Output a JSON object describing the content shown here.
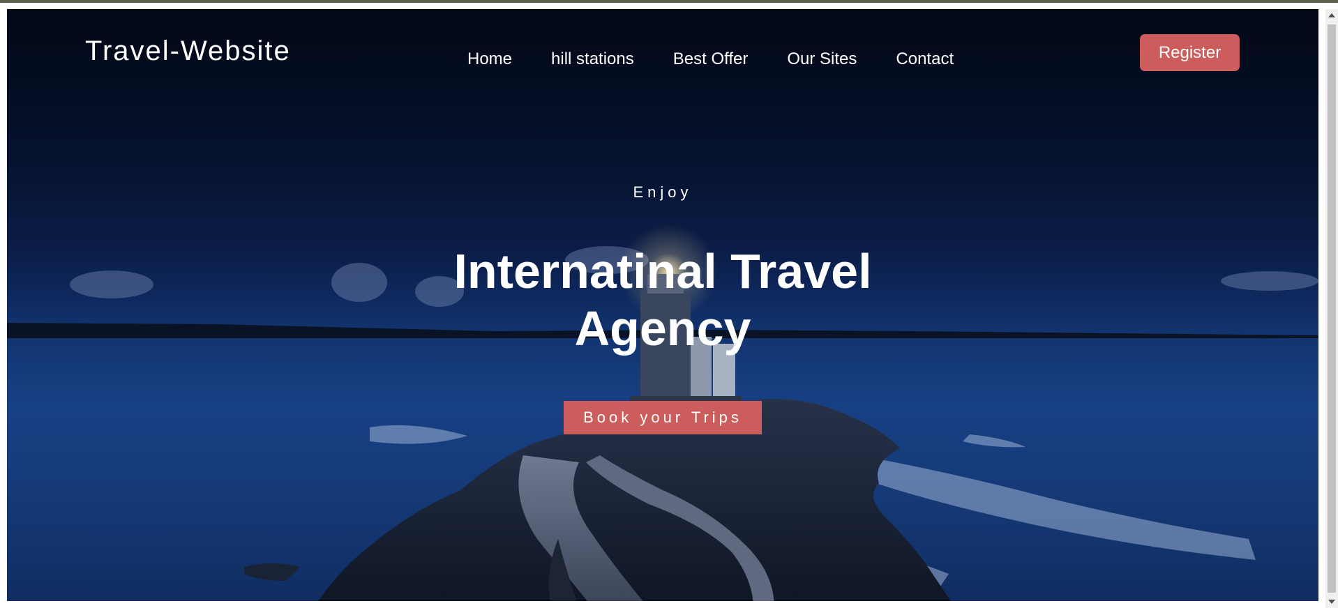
{
  "header": {
    "logo": "Travel-Website",
    "nav": [
      {
        "label": "Home"
      },
      {
        "label": "hill stations"
      },
      {
        "label": "Best Offer"
      },
      {
        "label": "Our Sites"
      },
      {
        "label": "Contact"
      }
    ],
    "register_label": "Register"
  },
  "hero": {
    "eyebrow": "Enjoy",
    "title_line1": "Internatinal Travel",
    "title_line2": "Agency",
    "cta_label": "Book your Trips",
    "background": "night-lighthouse-sea-image"
  },
  "colors": {
    "accent": "#cd5c5c",
    "text": "#ffffff",
    "sky_top": "#020816",
    "sea": "#174083"
  }
}
